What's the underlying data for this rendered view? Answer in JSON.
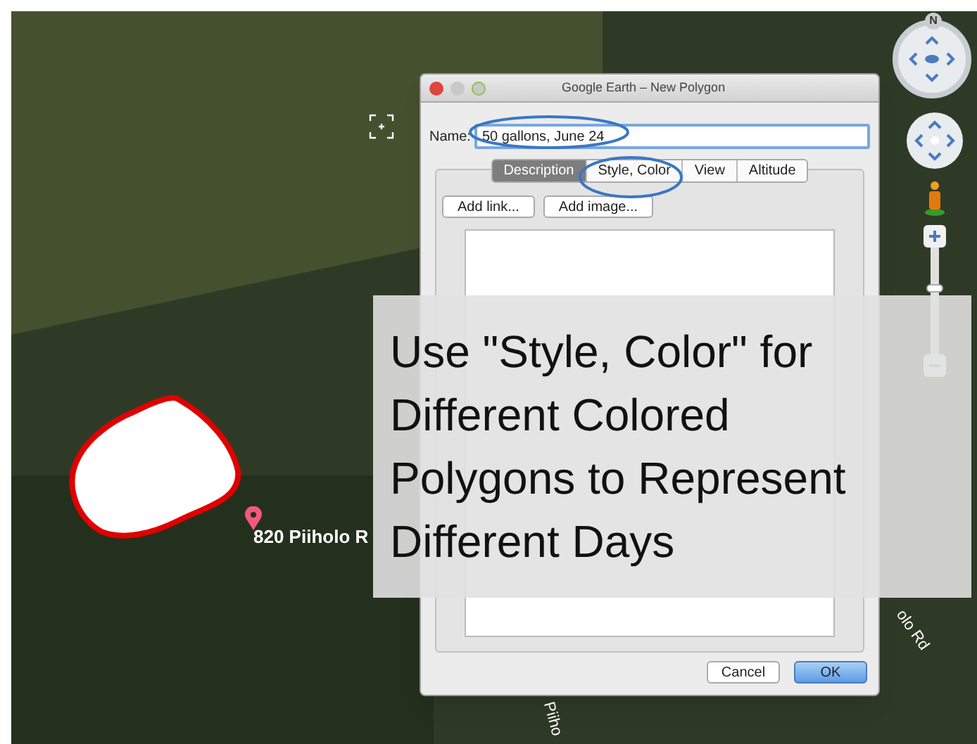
{
  "map": {
    "place_label": "820 Piiholo R",
    "road_labels": [
      {
        "text": "olo Rd",
        "kind": "right"
      },
      {
        "text": "Piiho",
        "kind": "bottom"
      }
    ],
    "compass_letter": "N",
    "zoom": {
      "level": 0.62
    }
  },
  "dialog": {
    "title": "Google Earth – New Polygon",
    "name_label": "Name:",
    "name_value": "50 gallons, June 24",
    "tabs": [
      {
        "label": "Description",
        "selected": true
      },
      {
        "label": "Style, Color",
        "selected": false
      },
      {
        "label": "View",
        "selected": false
      },
      {
        "label": "Altitude",
        "selected": false
      }
    ],
    "add_buttons": [
      "Add link...",
      "Add image..."
    ],
    "buttons": [
      {
        "label": "Cancel",
        "kind": "secondary"
      },
      {
        "label": "OK",
        "kind": "primary"
      }
    ]
  },
  "caption": {
    "lines": [
      "Use \"Style, Color\" for",
      "Different Colored",
      "Polygons to Represent",
      "Different Days"
    ]
  }
}
